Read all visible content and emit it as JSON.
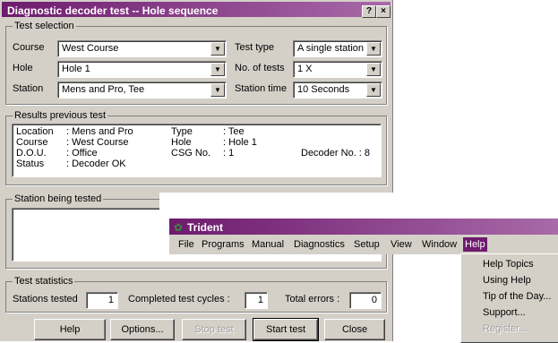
{
  "dialog": {
    "title": "Diagnostic decoder test  -- Hole sequence",
    "help_btn": "?",
    "close_btn": "×",
    "test_selection": {
      "label": "Test selection",
      "course_label": "Course",
      "course_value": "West Course",
      "hole_label": "Hole",
      "hole_value": "Hole 1",
      "station_label": "Station",
      "station_value": "Mens and Pro,  Tee",
      "test_type_label": "Test type",
      "test_type_value": "A single station",
      "no_tests_label": "No. of tests",
      "no_tests_value": "1 X",
      "station_time_label": "Station time",
      "station_time_value": "10 Seconds"
    },
    "results": {
      "label": "Results previous test",
      "location_label": "Location",
      "location_value": ": Mens and Pro",
      "course_label": "Course",
      "course_value": ": West Course",
      "dou_label": "D.O.U.",
      "dou_value": ": Office",
      "status_label": "Status",
      "status_value": ": Decoder OK",
      "type_label": "Type",
      "type_value": ": Tee",
      "hole_label": "Hole",
      "hole_value": ": Hole 1",
      "csg_label": "CSG No.",
      "csg_value": ": 1",
      "decoder_label": "Decoder No. : 8"
    },
    "station_tested": {
      "label": "Station being tested"
    },
    "statistics": {
      "label": "Test statistics",
      "stations_label": "Stations tested",
      "stations_value": "1",
      "cycles_label": "Completed test cycles :",
      "cycles_value": "1",
      "errors_label": "Total errors :",
      "errors_value": "0"
    },
    "buttons": {
      "help": "Help",
      "options": "Options...",
      "stop": "Stop test",
      "start": "Start test",
      "close": "Close"
    }
  },
  "trident": {
    "title": "Trident",
    "menu": [
      "File",
      "Programs",
      "Manual",
      "Diagnostics",
      "Setup",
      "View",
      "Window",
      "Help"
    ],
    "help_menu": [
      "Help Topics",
      "Using Help",
      "Tip of the Day...",
      "Support...",
      "Register..."
    ]
  }
}
